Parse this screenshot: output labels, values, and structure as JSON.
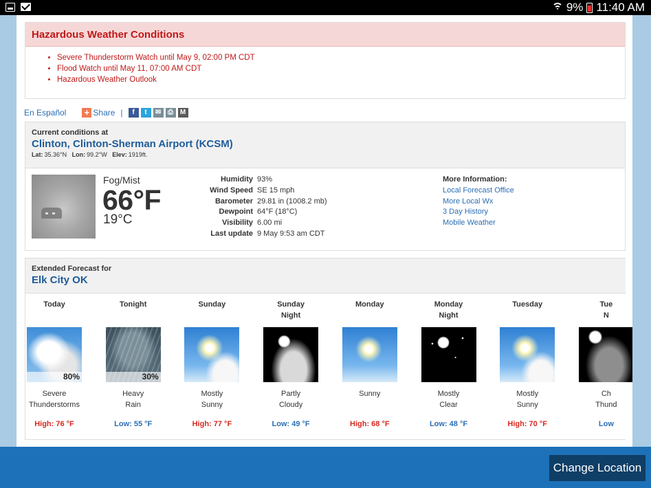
{
  "statusbar": {
    "battery": "9%",
    "time": "11:40 AM"
  },
  "hazard": {
    "title": "Hazardous Weather Conditions",
    "items": [
      "Severe Thunderstorm Watch until May 9, 02:00 PM CDT",
      "Flood Watch until May 11, 07:00 AM CDT",
      "Hazardous Weather Outlook"
    ]
  },
  "share": {
    "espanol": "En Español",
    "share_label": "Share",
    "separator": "|"
  },
  "current": {
    "heading": "Current conditions at",
    "station": "Clinton, Clinton-Sherman Airport (KCSM)",
    "lat_label": "Lat:",
    "lat": "35.36°N",
    "lon_label": "Lon:",
    "lon": "99.2°W",
    "elev_label": "Elev:",
    "elev": "1919ft.",
    "condition": "Fog/Mist",
    "temp_f": "66°F",
    "temp_c": "19°C",
    "details": [
      {
        "label": "Humidity",
        "value": "93%"
      },
      {
        "label": "Wind Speed",
        "value": "SE 15 mph"
      },
      {
        "label": "Barometer",
        "value": "29.81 in (1008.2 mb)"
      },
      {
        "label": "Dewpoint",
        "value": "64°F (18°C)"
      },
      {
        "label": "Visibility",
        "value": "6.00 mi"
      },
      {
        "label": "Last update",
        "value": "9 May 9:53 am CDT"
      }
    ],
    "more_heading": "More Information:",
    "more_links": [
      "Local Forecast Office",
      "More Local Wx",
      "3 Day History",
      "Mobile Weather"
    ]
  },
  "forecast": {
    "heading": "Extended Forecast for",
    "location": "Elk City OK",
    "periods": [
      {
        "name_1": "Today",
        "name_2": "",
        "icon": "thunderstorm-icon",
        "pct": "80%",
        "short_1": "Severe",
        "short_2": "Thunderstorms",
        "temp": "High: 76 °F",
        "kind": "hi"
      },
      {
        "name_1": "Tonight",
        "name_2": "",
        "icon": "heavy-rain-icon",
        "pct": "30%",
        "short_1": "Heavy",
        "short_2": "Rain",
        "temp": "Low: 55 °F",
        "kind": "lo"
      },
      {
        "name_1": "Sunday",
        "name_2": "",
        "icon": "mostly-sunny-icon",
        "pct": "",
        "short_1": "Mostly",
        "short_2": "Sunny",
        "temp": "High: 77 °F",
        "kind": "hi"
      },
      {
        "name_1": "Sunday",
        "name_2": "Night",
        "icon": "partly-cloudy-night-icon",
        "pct": "",
        "short_1": "Partly",
        "short_2": "Cloudy",
        "temp": "Low: 49 °F",
        "kind": "lo"
      },
      {
        "name_1": "Monday",
        "name_2": "",
        "icon": "sunny-icon",
        "pct": "",
        "short_1": "Sunny",
        "short_2": "",
        "temp": "High: 68 °F",
        "kind": "hi"
      },
      {
        "name_1": "Monday",
        "name_2": "Night",
        "icon": "mostly-clear-night-icon",
        "pct": "",
        "short_1": "Mostly",
        "short_2": "Clear",
        "temp": "Low: 48 °F",
        "kind": "lo"
      },
      {
        "name_1": "Tuesday",
        "name_2": "",
        "icon": "mostly-sunny-icon",
        "pct": "",
        "short_1": "Mostly",
        "short_2": "Sunny",
        "temp": "High: 70 °F",
        "kind": "hi"
      },
      {
        "name_1": "Tue",
        "name_2": "N",
        "icon": "thunderstorm-night-icon",
        "pct": "",
        "short_1": "Ch",
        "short_2": "Thund",
        "temp": "Low",
        "kind": "lo"
      }
    ]
  },
  "change_location": "Change Location"
}
